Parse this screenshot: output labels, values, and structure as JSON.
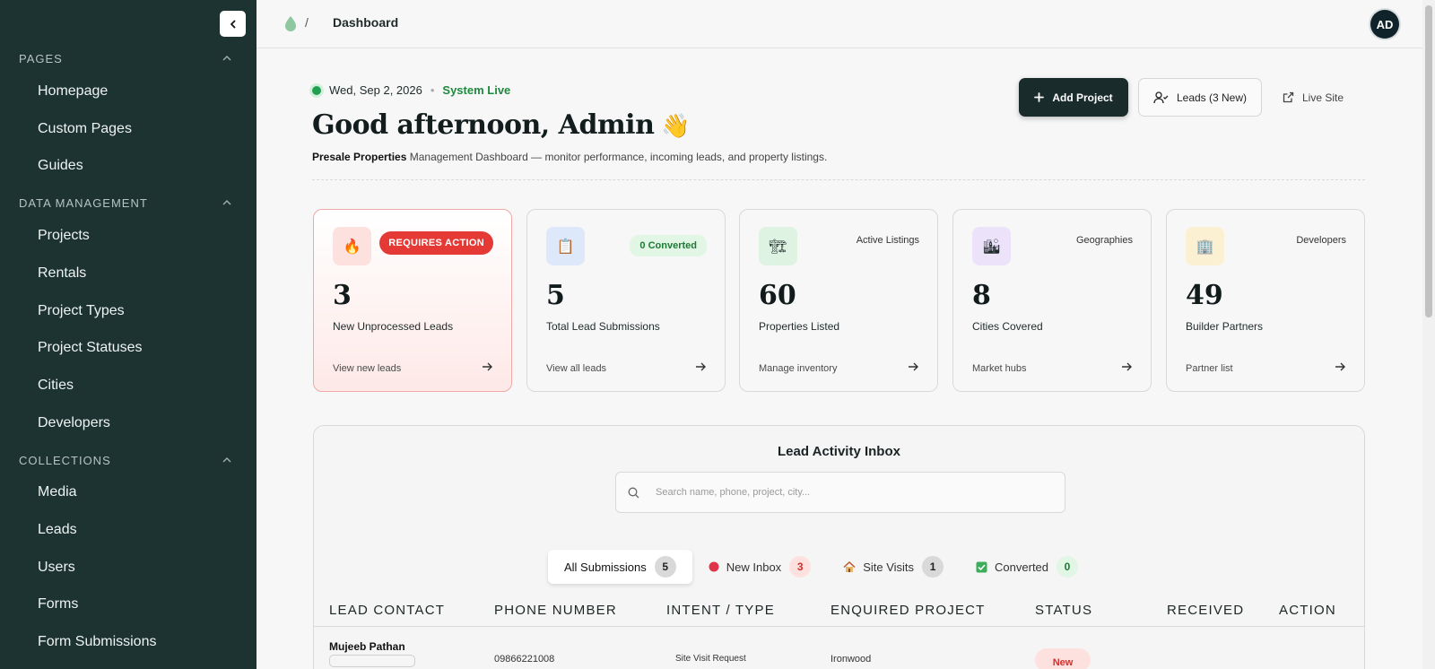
{
  "sidebar": {
    "sections": [
      {
        "title": "PAGES",
        "items": [
          "Homepage",
          "Custom Pages",
          "Guides"
        ]
      },
      {
        "title": "DATA MANAGEMENT",
        "items": [
          "Projects",
          "Rentals",
          "Project Types",
          "Project Statuses",
          "Cities",
          "Developers"
        ]
      },
      {
        "title": "COLLECTIONS",
        "items": [
          "Media",
          "Leads",
          "Users",
          "Forms",
          "Form Submissions"
        ]
      }
    ]
  },
  "topbar": {
    "breadcrumb_separator": "/",
    "breadcrumb_current": "Dashboard",
    "avatar_initials": "AD"
  },
  "header": {
    "date": "Wed, Sep 2, 2026",
    "separator": "•",
    "system_status": "System Live",
    "greeting": "Good afternoon, Admin",
    "greeting_emoji": "👋",
    "subtitle_brand": "Presale Properties",
    "subtitle_rest": " Management Dashboard — monitor performance, incoming leads, and property listings."
  },
  "actions": {
    "add_project": "Add Project",
    "leads": "Leads (3 New)",
    "live_site": "Live Site"
  },
  "stats": [
    {
      "icon": "🔥",
      "badge": "REQUIRES ACTION",
      "value": "3",
      "label": "New Unprocessed Leads",
      "link": "View new leads"
    },
    {
      "icon": "📋",
      "badge": "0 Converted",
      "value": "5",
      "label": "Total Lead Submissions",
      "link": "View all leads"
    },
    {
      "icon": "🏗",
      "badge": "Active Listings",
      "value": "60",
      "label": "Properties Listed",
      "link": "Manage inventory"
    },
    {
      "icon": "🏙",
      "badge": "Geographies",
      "value": "8",
      "label": "Cities Covered",
      "link": "Market hubs"
    },
    {
      "icon": "🏢",
      "badge": "Developers",
      "value": "49",
      "label": "Builder Partners",
      "link": "Partner list"
    }
  ],
  "inbox": {
    "title": "Lead Activity Inbox",
    "search_placeholder": "Search name, phone, project, city...",
    "filters": [
      {
        "label": "All Submissions",
        "count": "5"
      },
      {
        "label": "New Inbox",
        "count": "3"
      },
      {
        "label": "Site Visits",
        "count": "1"
      },
      {
        "label": "Converted",
        "count": "0"
      }
    ],
    "columns": [
      "LEAD CONTACT",
      "PHONE NUMBER",
      "INTENT / TYPE",
      "ENQUIRED PROJECT",
      "STATUS",
      "RECEIVED",
      "ACTION"
    ],
    "rows": [
      {
        "name": "Mujeeb Pathan",
        "phone": "09866221008",
        "intent": "Site Visit Request",
        "project": "Ironwood",
        "status": "New"
      }
    ]
  },
  "colors": {
    "sidebar_bg": "#1c3332",
    "primary_button": "#1a2b2b",
    "live_green": "#22a052",
    "alert_red": "#e53935",
    "converted_green": "#1d7a34"
  }
}
